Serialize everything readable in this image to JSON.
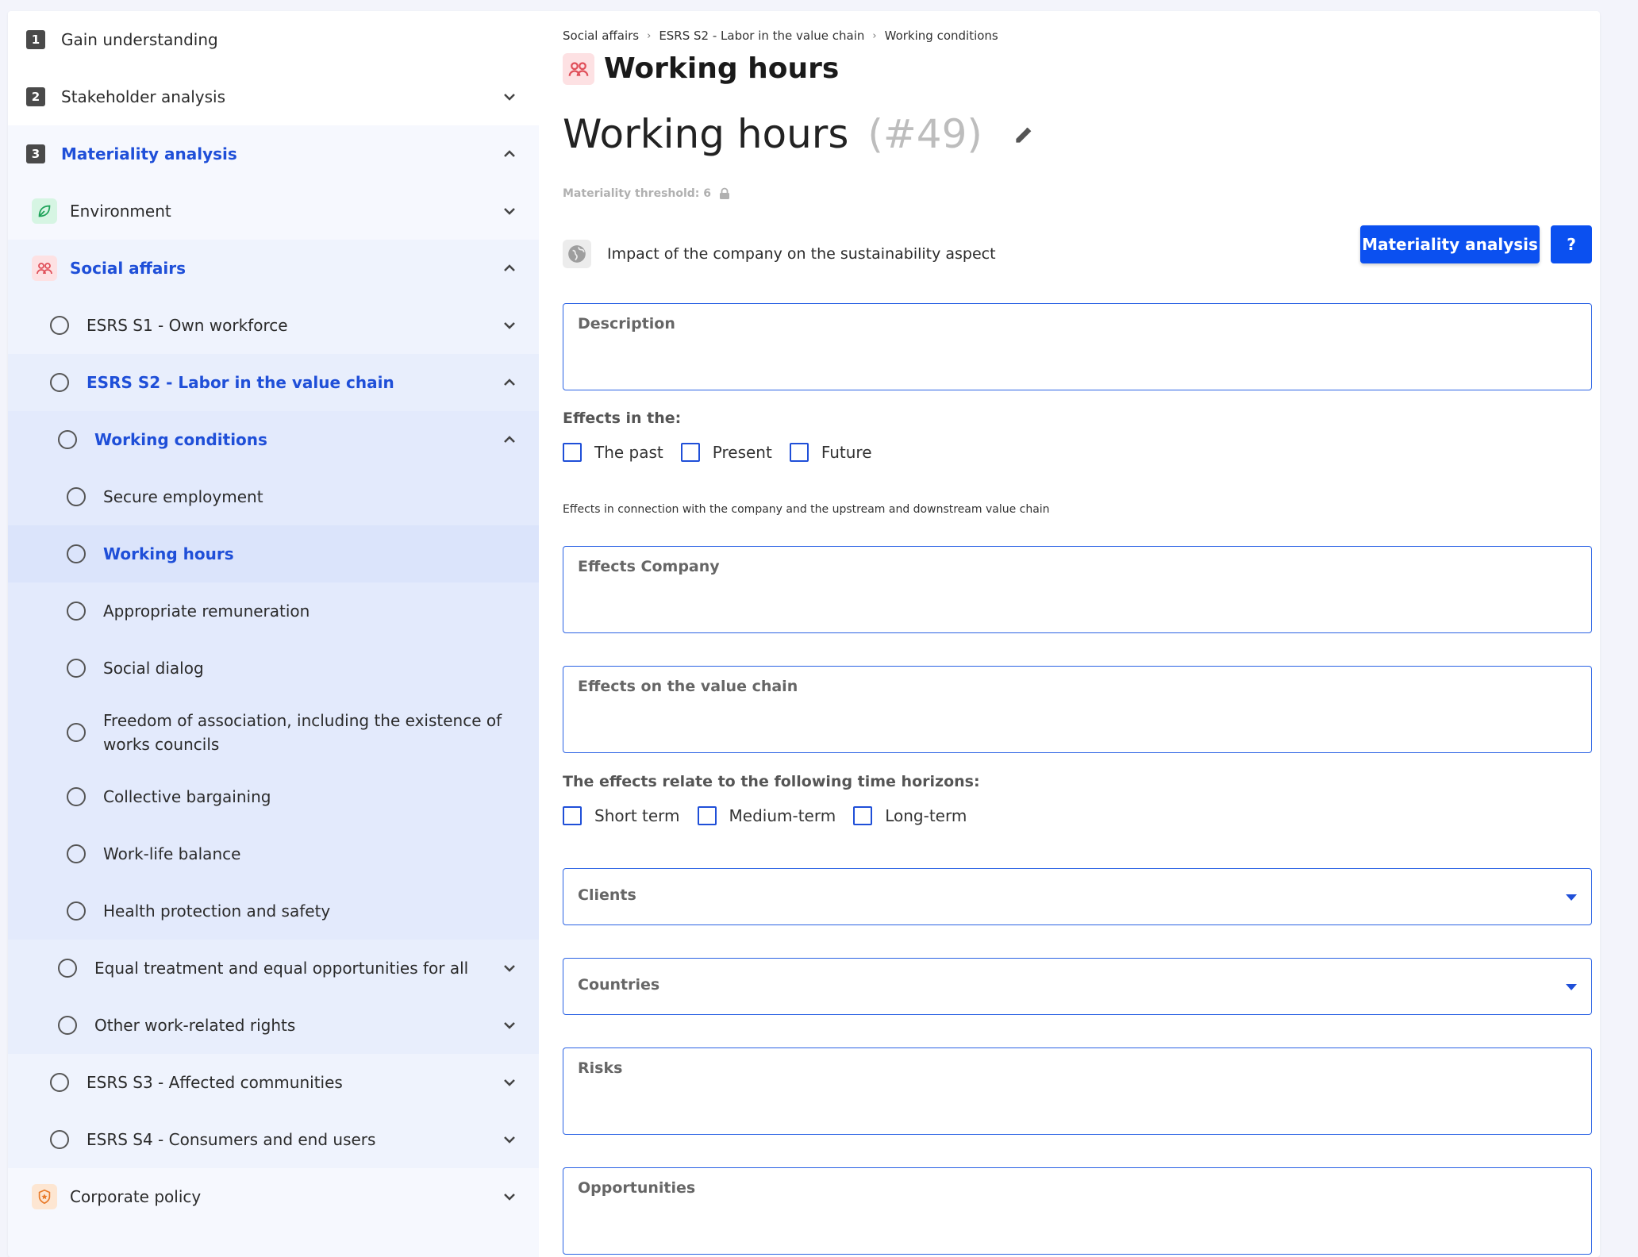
{
  "sidebar": {
    "steps": [
      {
        "num": "1",
        "label": "Gain understanding"
      },
      {
        "num": "2",
        "label": "Stakeholder analysis"
      },
      {
        "num": "3",
        "label": "Materiality analysis"
      }
    ],
    "categories": {
      "environment": "Environment",
      "social": "Social affairs",
      "corporate": "Corporate policy"
    },
    "standards": {
      "s1": "ESRS S1 - Own workforce",
      "s2": "ESRS S2 - Labor in the value chain",
      "s3": "ESRS S3 - Affected communities",
      "s4": "ESRS S4 - Consumers and end users"
    },
    "topics": {
      "working_conditions": "Working conditions",
      "equal_treatment": "Equal treatment and equal opportunities for all",
      "other_rights": "Other work-related rights"
    },
    "subtopics": [
      "Secure employment",
      "Working hours",
      "Appropriate remuneration",
      "Social dialog",
      "Freedom of association, including the existence of works councils",
      "Collective bargaining",
      "Work-life balance",
      "Health protection and safety"
    ]
  },
  "breadcrumb": [
    "Social affairs",
    "ESRS S2 - Labor in the value chain",
    "Working conditions"
  ],
  "header": {
    "title": "Working hours",
    "big_title": "Working hours",
    "number": "(#49)",
    "threshold": "Materiality threshold: 6"
  },
  "impact": {
    "text": "Impact of the company on the sustainability aspect",
    "button": "Materiality analysis",
    "help": "?"
  },
  "form": {
    "description": "Description",
    "effects_in_label": "Effects in the:",
    "effects_in": [
      "The past",
      "Present",
      "Future"
    ],
    "note": "Effects in connection with the company and the upstream and downstream value chain",
    "effects_company": "Effects Company",
    "effects_value_chain": "Effects on the value chain",
    "horizons_label": "The effects relate to the following time horizons:",
    "horizons": [
      "Short term",
      "Medium-term",
      "Long-term"
    ],
    "clients": "Clients",
    "countries": "Countries",
    "risks": "Risks",
    "opportunities": "Opportunities"
  },
  "colors": {
    "accent": "#0b50f0",
    "active_text": "#1f4fd8",
    "environment_bg": "#d6f5e3",
    "social_bg": "#fde1e3",
    "corporate_bg": "#fde6d2"
  }
}
